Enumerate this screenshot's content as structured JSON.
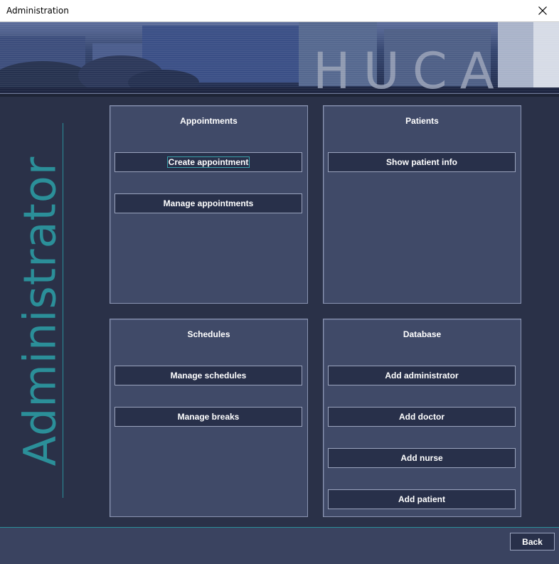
{
  "window": {
    "title": "Administration",
    "close_icon": "close-icon"
  },
  "banner": {
    "text": "HUCA"
  },
  "side_label": "Administrator",
  "panels": {
    "appointments": {
      "title": "Appointments",
      "buttons": [
        "Create appointment",
        "Manage appointments"
      ]
    },
    "patients": {
      "title": "Patients",
      "buttons": [
        "Show patient info"
      ]
    },
    "schedules": {
      "title": "Schedules",
      "buttons": [
        "Manage schedules",
        "Manage breaks"
      ]
    },
    "database": {
      "title": "Database",
      "buttons": [
        "Add administrator",
        "Add doctor",
        "Add nurse",
        "Add patient"
      ]
    }
  },
  "footer": {
    "back_label": "Back"
  },
  "colors": {
    "accent": "#2b8f99",
    "panel_bg": "#404a68",
    "button_bg": "#28304a",
    "window_bg": "#2a3148"
  }
}
